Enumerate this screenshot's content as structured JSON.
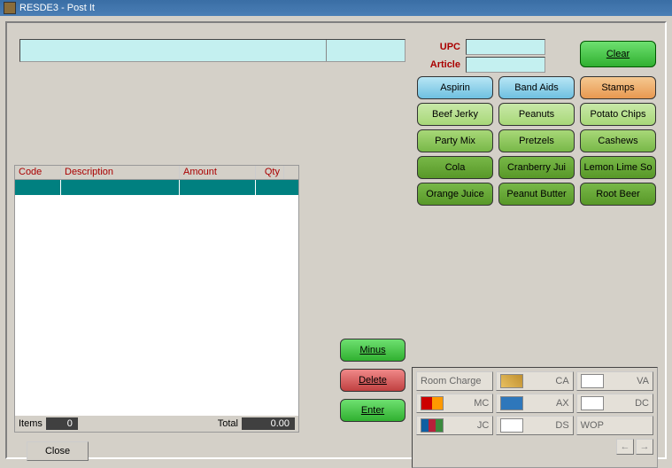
{
  "window": {
    "title": "RESDE3 - Post It"
  },
  "fields": {
    "upc_label": "UPC",
    "article_label": "Article",
    "upc_value": "",
    "article_value": ""
  },
  "clear_label": "Clear",
  "products": [
    {
      "label": "Aspirin",
      "tone": "lightblue"
    },
    {
      "label": "Band Aids",
      "tone": "lightblue"
    },
    {
      "label": "Stamps",
      "tone": "orange"
    },
    {
      "label": "Beef Jerky",
      "tone": "green1"
    },
    {
      "label": "Peanuts",
      "tone": "green1"
    },
    {
      "label": "Potato Chips",
      "tone": "green1"
    },
    {
      "label": "Party Mix",
      "tone": "green2"
    },
    {
      "label": "Pretzels",
      "tone": "green2"
    },
    {
      "label": "Cashews",
      "tone": "green2"
    },
    {
      "label": "Cola",
      "tone": "green3"
    },
    {
      "label": "Cranberry Jui",
      "tone": "green3"
    },
    {
      "label": "Lemon Lime So",
      "tone": "green3"
    },
    {
      "label": "Orange Juice",
      "tone": "green3"
    },
    {
      "label": "Peanut Butter",
      "tone": "green3"
    },
    {
      "label": "Root Beer",
      "tone": "green3"
    }
  ],
  "table": {
    "headers": {
      "code": "Code",
      "desc": "Description",
      "amt": "Amount",
      "qty": "Qty"
    },
    "footer": {
      "items_label": "Items",
      "items_value": "0",
      "total_label": "Total",
      "total_value": "0.00"
    }
  },
  "actions": {
    "minus": "Minus",
    "delete": "Delete",
    "enter": "Enter",
    "close": "Close"
  },
  "payments": {
    "cells": [
      {
        "label": "Room Charge",
        "abbr": "",
        "icon": ""
      },
      {
        "label": "",
        "abbr": "CA",
        "icon": "cash"
      },
      {
        "label": "",
        "abbr": "VA",
        "icon": "visa"
      },
      {
        "label": "",
        "abbr": "MC",
        "icon": "mc"
      },
      {
        "label": "",
        "abbr": "AX",
        "icon": "ax"
      },
      {
        "label": "",
        "abbr": "DC",
        "icon": "dc"
      },
      {
        "label": "",
        "abbr": "JC",
        "icon": "jcb"
      },
      {
        "label": "",
        "abbr": "DS",
        "icon": "ds"
      },
      {
        "label": "WOP",
        "abbr": "",
        "icon": ""
      }
    ],
    "nav": {
      "prev": "←",
      "next": "→"
    }
  }
}
